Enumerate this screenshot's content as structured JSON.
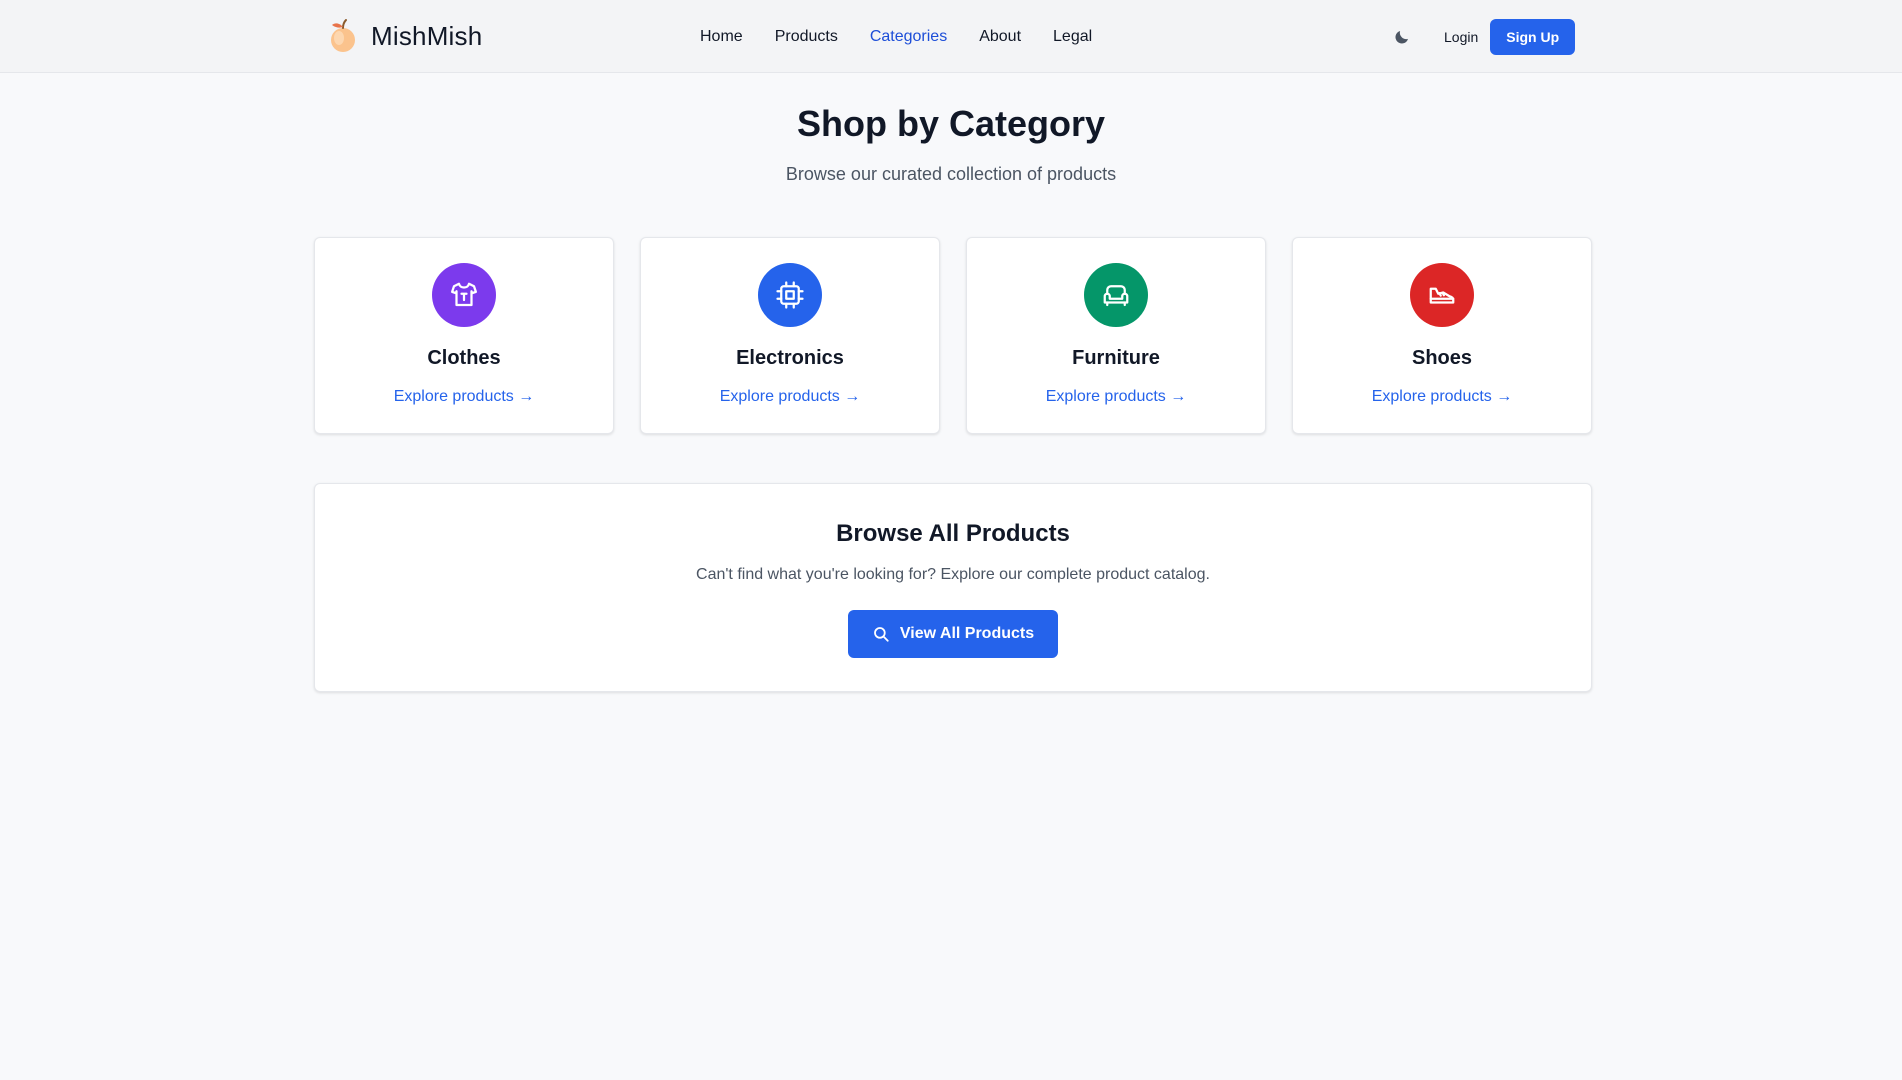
{
  "brand": {
    "name": "MishMish"
  },
  "nav": {
    "links": [
      {
        "label": "Home"
      },
      {
        "label": "Products"
      },
      {
        "label": "Categories",
        "active": true
      },
      {
        "label": "About"
      },
      {
        "label": "Legal"
      }
    ],
    "login_label": "Login",
    "signup_label": "Sign Up",
    "theme_icon": "moon-icon"
  },
  "hero": {
    "title": "Shop by Category",
    "subtitle": "Browse our curated collection of products"
  },
  "categories": [
    {
      "name": "Clothes",
      "link": "Explore products →",
      "icon": "shirt-icon",
      "color": "#7c3aed"
    },
    {
      "name": "Electronics",
      "link": "Explore products →",
      "icon": "chip-icon",
      "color": "#2563eb"
    },
    {
      "name": "Furniture",
      "link": "Explore products →",
      "icon": "sofa-icon",
      "color": "#059669"
    },
    {
      "name": "Shoes",
      "link": "Explore products →",
      "icon": "shoe-icon",
      "color": "#dc2626"
    }
  ],
  "browse": {
    "title": "Browse All Products",
    "text": "Can't find what you're looking for? Explore our complete product catalog.",
    "button_label": "View All Products",
    "button_icon": "search-icon"
  },
  "colors": {
    "accent": "#2563eb",
    "background": "#f8f9fb",
    "header": "#f3f4f6"
  }
}
